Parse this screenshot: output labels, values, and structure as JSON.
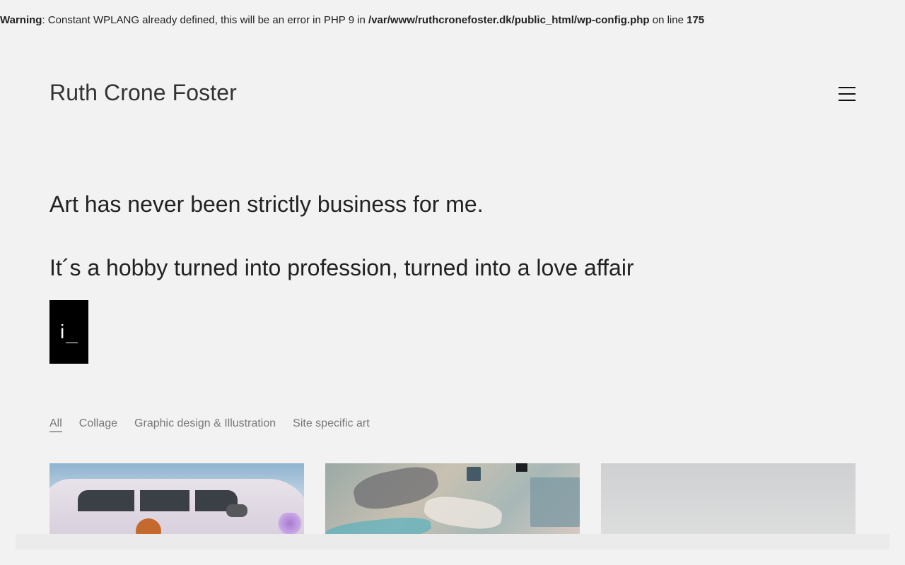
{
  "php_warning": {
    "label": "Warning",
    "message": ": Constant WPLANG already defined, this will be an error in PHP 9 in ",
    "path": "/var/www/ruthcronefoster.dk/public_html/wp-config.php",
    "line_text": " on line ",
    "line_number": "175"
  },
  "header": {
    "site_title": "Ruth Crone Foster",
    "menu_icon": "hamburger-menu-icon"
  },
  "intro": {
    "line1": "Art has never been strictly business for me.",
    "line2": "It´s a hobby turned into profession, turned into a love affair"
  },
  "logo": {
    "glyph": "i"
  },
  "filters": [
    {
      "label": "All",
      "active": true
    },
    {
      "label": "Collage",
      "active": false
    },
    {
      "label": "Graphic design & Illustration",
      "active": false
    },
    {
      "label": "Site specific art",
      "active": false
    }
  ],
  "colors": {
    "background": "#f2f2f2",
    "text": "#222222",
    "muted": "#777777",
    "logo_bg": "#000000"
  }
}
